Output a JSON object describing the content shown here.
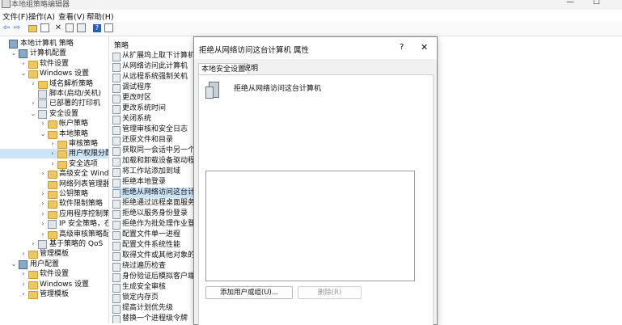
{
  "window": {
    "title": "本地组策略编辑器",
    "min": "—",
    "max": "☐",
    "close": "✕"
  },
  "menu": [
    "文件(F)",
    "操作(A)",
    "查看(V)",
    "帮助(H)"
  ],
  "tree": [
    {
      "label": "本地计算机 策略",
      "icon": "computer",
      "level": 0,
      "twisty": ""
    },
    {
      "label": "计算机配置",
      "icon": "computer",
      "level": 1,
      "twisty": "⌄"
    },
    {
      "label": "软件设置",
      "icon": "folder",
      "level": 2,
      "twisty": "›"
    },
    {
      "label": "Windows 设置",
      "icon": "folder",
      "level": 2,
      "twisty": "⌄"
    },
    {
      "label": "域名解析策略",
      "icon": "folder",
      "level": 3,
      "twisty": "›"
    },
    {
      "label": "脚本(启动/关机)",
      "icon": "script",
      "level": 3,
      "twisty": ""
    },
    {
      "label": "已部署的打印机",
      "icon": "printer",
      "level": 3,
      "twisty": "›"
    },
    {
      "label": "安全设置",
      "icon": "security",
      "level": 3,
      "twisty": "⌄"
    },
    {
      "label": "帐户策略",
      "icon": "folder",
      "level": 4,
      "twisty": "›"
    },
    {
      "label": "本地策略",
      "icon": "folder",
      "level": 4,
      "twisty": "⌄"
    },
    {
      "label": "审核策略",
      "icon": "folder",
      "level": 5,
      "twisty": "›"
    },
    {
      "label": "用户权限分配",
      "icon": "folder",
      "level": 5,
      "twisty": "›",
      "selected": true
    },
    {
      "label": "安全选项",
      "icon": "folder",
      "level": 5,
      "twisty": "›"
    },
    {
      "label": "高级安全 Windows D",
      "icon": "folder",
      "level": 4,
      "twisty": "›"
    },
    {
      "label": "网络列表管理器策略",
      "icon": "folder",
      "level": 4,
      "twisty": ""
    },
    {
      "label": "公钥策略",
      "icon": "folder",
      "level": 4,
      "twisty": "›"
    },
    {
      "label": "软件限制策略",
      "icon": "folder",
      "level": 4,
      "twisty": "›"
    },
    {
      "label": "应用程序控制策略",
      "icon": "folder",
      "level": 4,
      "twisty": "›"
    },
    {
      "label": "IP 安全策略，在 本地",
      "icon": "security",
      "level": 4,
      "twisty": "›"
    },
    {
      "label": "高级审核策略配置",
      "icon": "folder",
      "level": 4,
      "twisty": "›"
    },
    {
      "label": "基于策略的 QoS",
      "icon": "chart",
      "level": 3,
      "twisty": "›"
    },
    {
      "label": "管理模板",
      "icon": "folder",
      "level": 2,
      "twisty": "›"
    },
    {
      "label": "用户配置",
      "icon": "user",
      "level": 1,
      "twisty": "⌄"
    },
    {
      "label": "软件设置",
      "icon": "folder",
      "level": 2,
      "twisty": "›"
    },
    {
      "label": "Windows 设置",
      "icon": "folder",
      "level": 2,
      "twisty": "›"
    },
    {
      "label": "管理模板",
      "icon": "folder",
      "level": 2,
      "twisty": "›"
    }
  ],
  "policy_header": "策略",
  "policies": [
    "从扩展坞上取下计算机",
    "从网络访问此计算机",
    "从远程系统强制关机",
    "调试程序",
    "更改时区",
    "更改系统时间",
    "关闭系统",
    "管理审核和安全日志",
    "还原文件和目录",
    "获取同一会话中另一个用户",
    "加载和卸载设备驱动程序",
    "将工作站添加到域",
    "拒绝本地登录",
    "拒绝从网络访问这台计算机",
    "拒绝通过远程桌面服务登录",
    "拒绝以服务身份登录",
    "拒绝作为批处理作业登录",
    "配置文件单一进程",
    "配置文件系统性能",
    "取得文件或其他对象的所有",
    "绕过遍历检查",
    "身份验证后模拟客户端",
    "生成安全审核",
    "锁定内存页",
    "提高计划优先级",
    "替换一个进程级令牌"
  ],
  "selected_policy_index": 13,
  "dialog": {
    "title": "拒绝从网络访问这台计算机 属性",
    "help": "?",
    "close": "✕",
    "tabs": [
      "本地安全设置",
      "说明"
    ],
    "heading": "拒绝从网络访问这台计算机",
    "add_button": "添加用户或组(U)...",
    "remove_button": "删除(R)"
  },
  "colors": {
    "selection": "#cce4f7",
    "accent": "#0067c0"
  }
}
